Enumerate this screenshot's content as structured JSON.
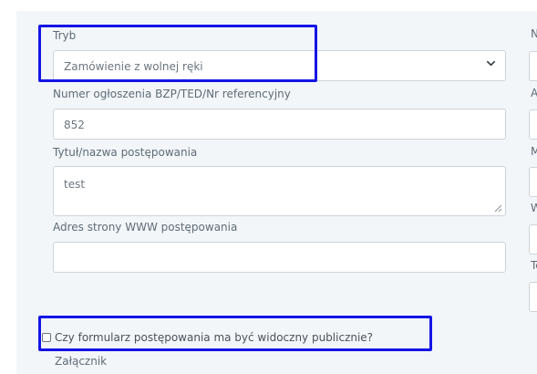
{
  "form": {
    "tryb": {
      "label": "Tryb",
      "selected": "Zamówienie z wolnej ręki",
      "chevron_icon": "chevron-down-icon"
    },
    "numer_ogloszenia": {
      "label": "Numer ogłoszenia BZP/TED/Nr referencyjny",
      "value": "852"
    },
    "tytul": {
      "label": "Tytuł/nazwa postępowania",
      "value": "test"
    },
    "adres_www": {
      "label": "Adres strony WWW postępowania",
      "value": ""
    },
    "public_checkbox": {
      "label": "Czy formularz postępowania ma być widoczny publicznie?",
      "checked": false
    },
    "zalacznik": {
      "label": "Załącznik"
    }
  },
  "right_column": {
    "label_initials": [
      "N",
      "A",
      "M",
      "W",
      "Te"
    ]
  },
  "colors": {
    "highlight_border": "#1414e6",
    "panel_background": "#f3f6f9",
    "input_border": "#cdd4da"
  }
}
